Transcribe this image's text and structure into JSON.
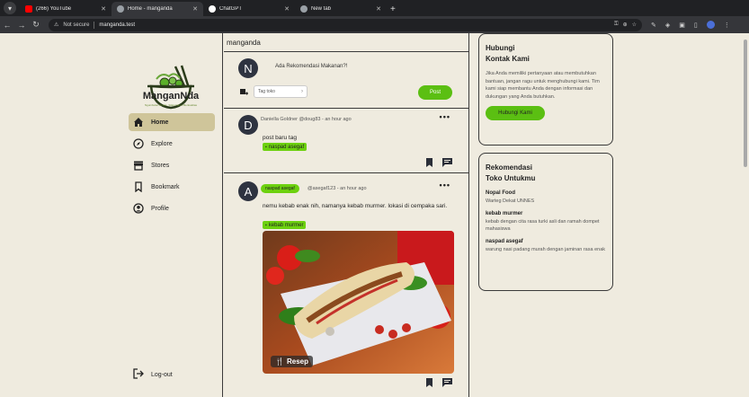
{
  "browser": {
    "tabs": [
      {
        "title": "(266) YouTube",
        "color": "#ff0000"
      },
      {
        "title": "Home - manganda",
        "color": "#9aa0a6"
      },
      {
        "title": "ChatGPT",
        "color": "#ffffff"
      },
      {
        "title": "New tab",
        "color": "#9aa0a6"
      }
    ],
    "security": "Not secure",
    "url": "manganda.test"
  },
  "sidebar": {
    "brand": "ManganNda",
    "tagline": "Ngumbulan Bebas, Silaturrahmi Berkualitas",
    "items": [
      {
        "label": "Home",
        "icon": "home-icon"
      },
      {
        "label": "Explore",
        "icon": "compass-icon"
      },
      {
        "label": "Stores",
        "icon": "store-icon"
      },
      {
        "label": "Bookmark",
        "icon": "bookmark-icon"
      },
      {
        "label": "Profile",
        "icon": "profile-icon"
      }
    ],
    "logout": "Log-out"
  },
  "main": {
    "title": "manganda",
    "composer": {
      "avatar": "N",
      "prompt": "Ada Rekomendasi Makanan?!",
      "tag_placeholder": "Tag toko",
      "post_label": "Post"
    },
    "posts": [
      {
        "avatar": "D",
        "meta": "Daniella Goldner @doug83 - an hour ago",
        "text": "post baru tag",
        "tag": "naspad asegaf"
      },
      {
        "avatar": "A",
        "pill": "naspad asegaf",
        "meta": "@asegaf123 - an hour ago",
        "text": "nemu kebab enak nih, namanya kebab murmer. lokasi di cempaka sari.",
        "tag": "kebab murmer",
        "image_label": "Resep"
      }
    ]
  },
  "contact": {
    "title_1": "Hubungi",
    "title_2": "Kontak Kami",
    "desc": "Jika Anda memiliki pertanyaan atau membutuhkan bantuan, jangan ragu untuk menghubungi kami. Tim kami siap membantu Anda dengan informasi dan dukungan yang Anda butuhkan.",
    "button": "Hubungi Kami"
  },
  "recommend": {
    "title_1": "Rekomendasi",
    "title_2": "Toko Untukmu",
    "stores": [
      {
        "name": "Nopal Food",
        "desc": "Warteg Dekat UNNES"
      },
      {
        "name": "kebab murmer",
        "desc": "kebab dengan cita rasa turki asli dan ramah dompet mahasiswa"
      },
      {
        "name": "naspad asegaf",
        "desc": "warung nasi padang murah dengan jaminan rasa enak"
      }
    ]
  },
  "colors": {
    "accent": "#5bbf12",
    "tag": "#6dd10f",
    "bg": "#efebdf"
  }
}
